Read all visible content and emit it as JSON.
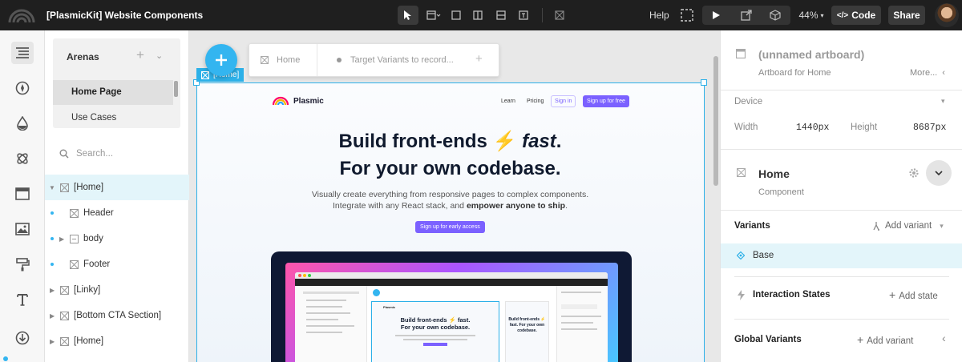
{
  "topbar": {
    "title": "[PlasmicKit] Website Components",
    "help_label": "Help",
    "zoom": "44%",
    "code_label": "Code",
    "share_label": "Share"
  },
  "arenas": {
    "title": "Arenas",
    "items": [
      "Home Page",
      "Use Cases"
    ]
  },
  "search": {
    "placeholder": "Search..."
  },
  "tree": [
    {
      "label": "[Home]"
    },
    {
      "label": "Header"
    },
    {
      "label": "body"
    },
    {
      "label": "Footer"
    },
    {
      "label": "[Linky]"
    },
    {
      "label": "[Bottom CTA Section]"
    },
    {
      "label": "[Home]"
    }
  ],
  "canvas": {
    "tabs": [
      "Home",
      "Target Variants to record..."
    ],
    "frame_tag": "[Home]",
    "site": {
      "logo_text": "Plasmic",
      "nav": [
        "Learn",
        "Pricing",
        "Sign in"
      ],
      "nav_cta": "Sign up for free",
      "headline_1": "Build front-ends",
      "headline_bolt": "⚡",
      "headline_fast": "fast",
      "headline_dot": ".",
      "headline_2": "For your own codebase.",
      "sub_1": "Visually create everything from responsive pages to complex components.",
      "sub_2a": "Integrate with any React stack, and ",
      "sub_2b": "empower anyone to ship",
      "sub_2c": ".",
      "cta": "Sign up for early access",
      "mini_headline": "Build front-ends ⚡ fast.",
      "mini_headline_2": "For your own codebase.",
      "mini_headline_right": "Build front-ends ⚡ fast. For your own codebase.",
      "mini_logo": "Plasmic"
    }
  },
  "rightpanel": {
    "artboard_title": "(unnamed artboard)",
    "artboard_sub": "Artboard for Home",
    "more_label": "More...",
    "device_label": "Device",
    "width_label": "Width",
    "width_value": "1440px",
    "height_label": "Height",
    "height_value": "8687px",
    "component_title": "Home",
    "component_sub": "Component",
    "variants_label": "Variants",
    "add_variant_label": "Add variant",
    "base_label": "Base",
    "interaction_label": "Interaction States",
    "add_state_label": "Add state",
    "global_variants_label": "Global Variants",
    "add_global_variant_label": "Add variant"
  },
  "colors": {
    "accent": "#7b61ff",
    "selection": "#2cb0e8",
    "plus_button": "#33b5f0"
  }
}
